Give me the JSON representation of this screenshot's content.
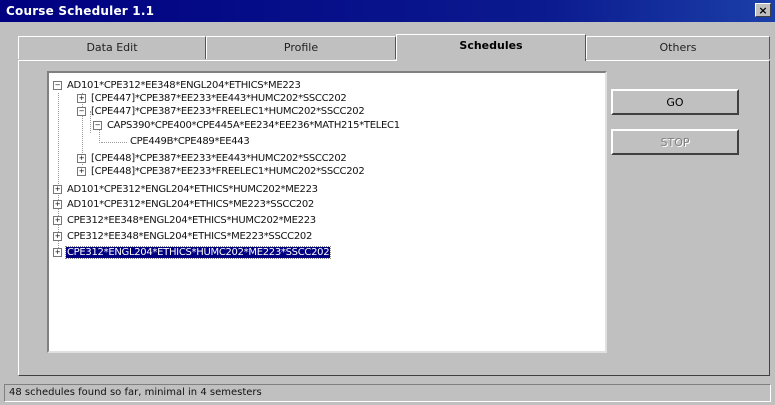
{
  "window": {
    "title": "Course Scheduler 1.1",
    "close_glyph": "×"
  },
  "tabs": [
    {
      "label": "Data Edit"
    },
    {
      "label": "Profile"
    },
    {
      "label": "Schedules"
    },
    {
      "label": "Others"
    }
  ],
  "active_tab": "Schedules",
  "tree": {
    "nodes": [
      {
        "label": "AD101*CPE312*EE348*ENGL204*ETHICS*ME223",
        "expander": "−"
      },
      {
        "label": "[CPE447]*CPE387*EE233*EE443*HUMC202*SSCC202",
        "expander": "+"
      },
      {
        "label": "[CPE447]*CPE387*EE233*FREELEC1*HUMC202*SSCC202",
        "expander": "−"
      },
      {
        "label": "CAPS390*CPE400*CPE445A*EE234*EE236*MATH215*TELEC1",
        "expander": "−"
      },
      {
        "label": "CPE449B*CPE489*EE443",
        "expander": ""
      },
      {
        "label": "[CPE448]*CPE387*EE233*EE443*HUMC202*SSCC202",
        "expander": "+"
      },
      {
        "label": "[CPE448]*CPE387*EE233*FREELEC1*HUMC202*SSCC202",
        "expander": "+"
      },
      {
        "label": "AD101*CPE312*ENGL204*ETHICS*HUMC202*ME223",
        "expander": "+"
      },
      {
        "label": "AD101*CPE312*ENGL204*ETHICS*ME223*SSCC202",
        "expander": "+"
      },
      {
        "label": "CPE312*EE348*ENGL204*ETHICS*HUMC202*ME223",
        "expander": "+"
      },
      {
        "label": "CPE312*EE348*ENGL204*ETHICS*ME223*SSCC202",
        "expander": "+"
      },
      {
        "label": "CPE312*ENGL204*ETHICS*HUMC202*ME223*SSCC202",
        "expander": "+"
      }
    ]
  },
  "buttons": {
    "go": "GO",
    "stop": "STOP"
  },
  "status": {
    "text": "48 schedules found so far, minimal in 4 semesters"
  },
  "colors": {
    "titlebar": "#000080",
    "selection": "#000080",
    "face": "#c0c0c0"
  }
}
